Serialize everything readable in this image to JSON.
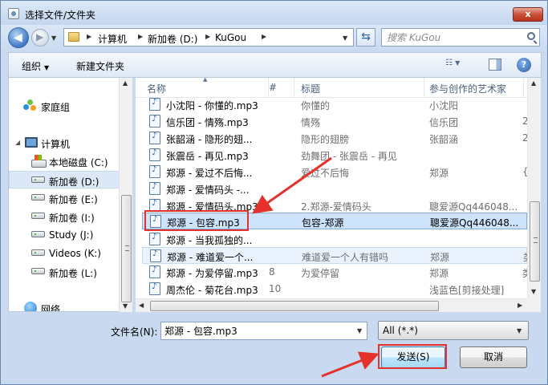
{
  "window": {
    "title": "选择文件/文件夹",
    "close_label": "x"
  },
  "nav": {
    "back_glyph": "◀",
    "forward_glyph": "▶",
    "breadcrumbs": [
      "计算机",
      "新加卷 (D:)",
      "KuGou"
    ],
    "search_placeholder": "搜索 KuGou"
  },
  "toolbar": {
    "organize_label": "组织",
    "new_folder_label": "新建文件夹",
    "help_label": "?"
  },
  "sidebar": {
    "items": [
      {
        "label": "家庭组",
        "icon": "homegroup-icon"
      },
      {
        "label": "计算机",
        "icon": "computer-icon"
      },
      {
        "label": "本地磁盘 (C:)",
        "icon": "system-drive-icon"
      },
      {
        "label": "新加卷 (D:)",
        "icon": "drive-icon",
        "selected": true
      },
      {
        "label": "新加卷 (E:)",
        "icon": "drive-icon"
      },
      {
        "label": "新加卷 (I:)",
        "icon": "drive-icon"
      },
      {
        "label": "Study (J:)",
        "icon": "drive-icon"
      },
      {
        "label": "Videos (K:)",
        "icon": "drive-icon"
      },
      {
        "label": "新加卷 (L:)",
        "icon": "drive-icon"
      },
      {
        "label": "网络",
        "icon": "network-icon"
      }
    ]
  },
  "file_list": {
    "columns": [
      "名称",
      "#",
      "标题",
      "参与创作的艺术家"
    ],
    "rows": [
      {
        "name": "小沈阳 - 你懂的.mp3",
        "num": "",
        "title": "你懂的",
        "artist": "小沈阳",
        "extra": ""
      },
      {
        "name": "信乐团 - 情殇.mp3",
        "num": "",
        "title": "情殇",
        "artist": "信乐团",
        "extra": "2"
      },
      {
        "name": "张韶涵 - 隐形的翅...",
        "num": "",
        "title": "隐形的翅膀",
        "artist": "张韶涵",
        "extra": "2"
      },
      {
        "name": "张震岳 - 再见.mp3",
        "num": "",
        "title": "劲舞团 - 张震岳 - 再见",
        "artist": "",
        "extra": ""
      },
      {
        "name": "郑源 - 爱过不后悔...",
        "num": "",
        "title": "爱过不后悔",
        "artist": "郑源",
        "extra": "{"
      },
      {
        "name": "郑源 - 爱情码头 -...",
        "num": "",
        "title": "",
        "artist": "",
        "extra": ""
      },
      {
        "name": "郑源 - 爱情码头.mp3",
        "num": "",
        "title": "2.郑源-爱情码头",
        "artist": "聰爱源Qq446048...",
        "extra": ""
      },
      {
        "name": "郑源 - 包容.mp3",
        "num": "",
        "title": "包容-郑源",
        "artist": "聰爱源Qq446048...",
        "extra": "",
        "selected": true
      },
      {
        "name": "郑源 - 当我孤独的...",
        "num": "",
        "title": "",
        "artist": "",
        "extra": ""
      },
      {
        "name": "郑源 - 难道爱一个...",
        "num": "",
        "title": "难道爱一个人有错吗",
        "artist": "郑源",
        "extra": "类"
      },
      {
        "name": "郑源 - 为爱停留.mp3",
        "num": "8",
        "title": "为爱停留",
        "artist": "郑源",
        "extra": "类"
      },
      {
        "name": "周杰伦 - 菊花台.mp3",
        "num": "10",
        "title": "",
        "artist": "浅蓝色[剪接处理]",
        "extra": ""
      }
    ]
  },
  "footer": {
    "filename_label": "文件名(N):",
    "filename_value": "郑源 - 包容.mp3",
    "filetype_value": "All (*.*)",
    "send_label": "发送(S)",
    "cancel_label": "取消"
  },
  "colors": {
    "annotation_red": "#e4312b",
    "selection_blue": "#cde2fb",
    "chrome_blue": "#c9daf0"
  }
}
